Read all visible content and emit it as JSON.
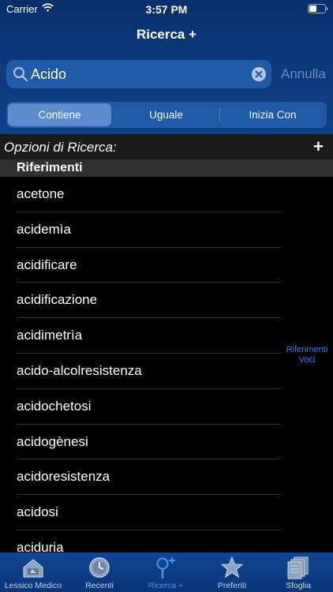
{
  "status": {
    "carrier": "Carrier",
    "time": "3:57 PM"
  },
  "nav": {
    "title": "Ricerca +"
  },
  "search": {
    "value": "Acido",
    "cancel_label": "Annulla"
  },
  "segments": [
    "Contiene",
    "Uguale",
    "Inizia Con"
  ],
  "selected_segment": "Contiene",
  "options": {
    "label": "Opzioni di Ricerca:",
    "add": "+"
  },
  "section": {
    "title": "Riferimenti"
  },
  "results": [
    "acetone",
    "acidemìa",
    "acidificare",
    "acidificazione",
    "acidimetrìa",
    "acido-alcolresistenza",
    "acidochetosi",
    "acidogènesi",
    "acidoresistenza",
    "acidosi",
    "aciduria"
  ],
  "index": {
    "line1": "Riferimenti",
    "line2": "Voci"
  },
  "tabs": [
    {
      "label": "Lessico Medico",
      "icon": "house-icon"
    },
    {
      "label": "Recenti",
      "icon": "clock-icon"
    },
    {
      "label": "Ricerca +",
      "icon": "search-plus-icon",
      "active": true
    },
    {
      "label": "Preferiti",
      "icon": "star-icon"
    },
    {
      "label": "Sfoglia",
      "icon": "pages-icon"
    }
  ],
  "colors": {
    "nav_blue": "#0b3777",
    "accent": "#4a8fe8",
    "index_blue": "#3e7bd9"
  }
}
